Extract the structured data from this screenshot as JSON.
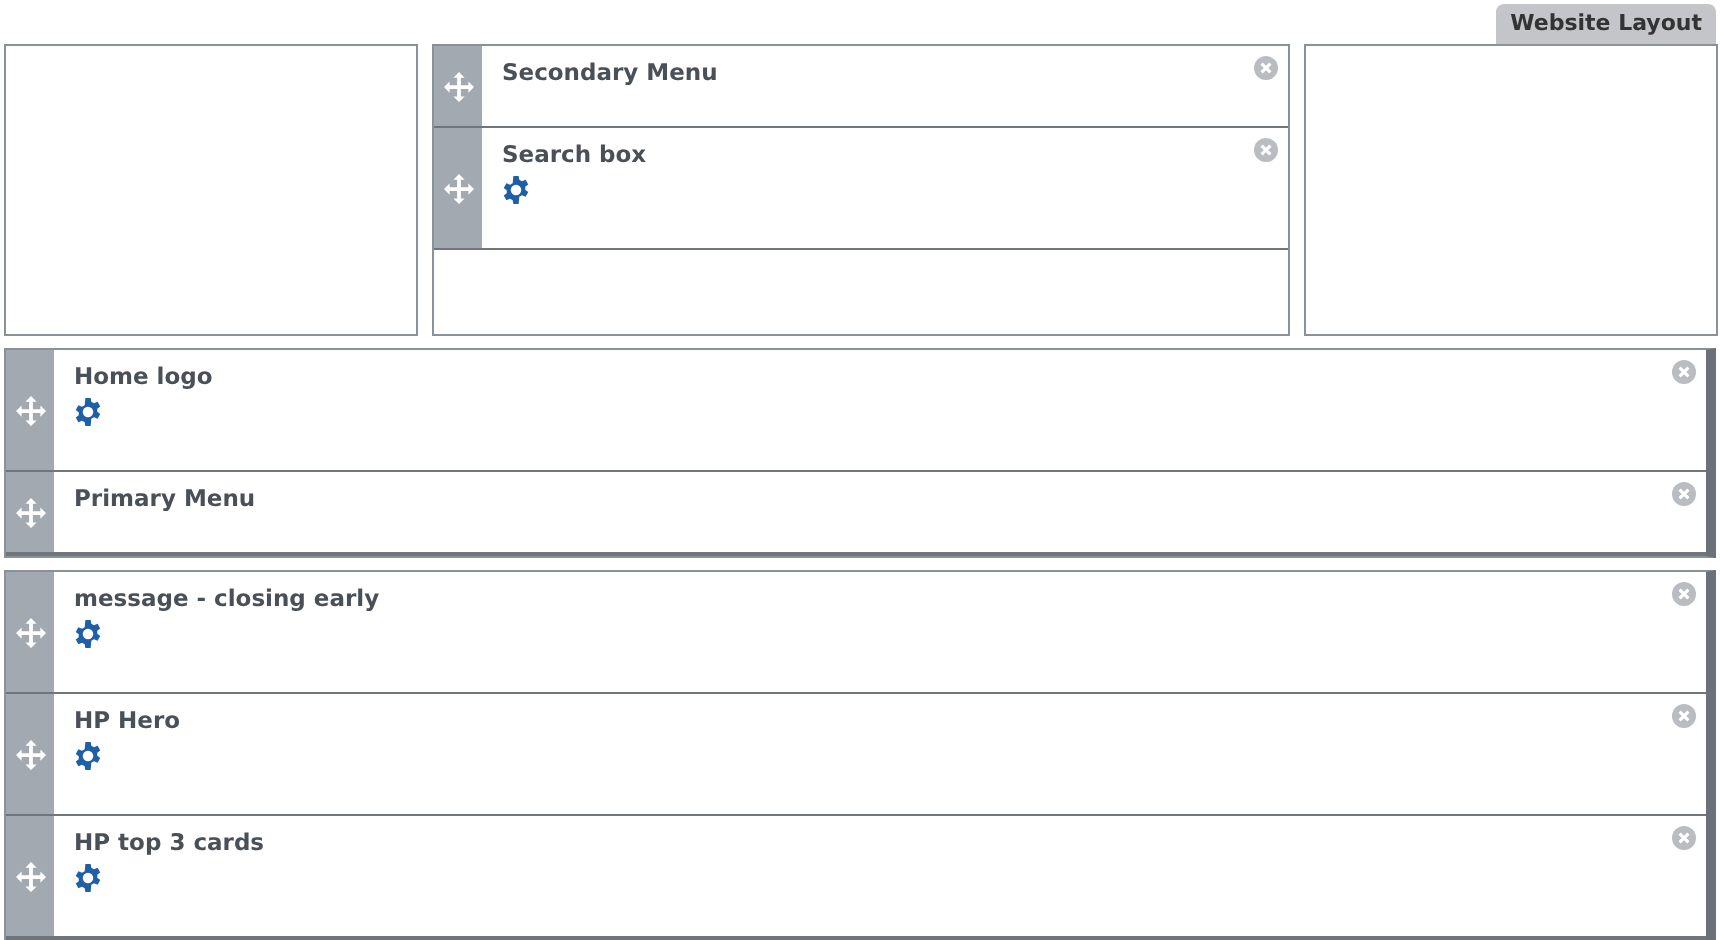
{
  "layout_tab": {
    "label": "Website Layout"
  },
  "top_regions": [
    {
      "kind": "empty"
    },
    {
      "kind": "blocks",
      "blocks": [
        {
          "label": "Secondary Menu",
          "configurable": false
        },
        {
          "label": "Search box",
          "configurable": true
        }
      ]
    },
    {
      "kind": "empty"
    }
  ],
  "sections": [
    {
      "blocks": [
        {
          "label": "Home logo",
          "configurable": true
        },
        {
          "label": "Primary Menu",
          "configurable": false
        }
      ]
    },
    {
      "blocks": [
        {
          "label": "message - closing early",
          "configurable": true
        },
        {
          "label": "HP Hero",
          "configurable": true
        },
        {
          "label": "HP top 3 cards",
          "configurable": true
        }
      ]
    }
  ]
}
